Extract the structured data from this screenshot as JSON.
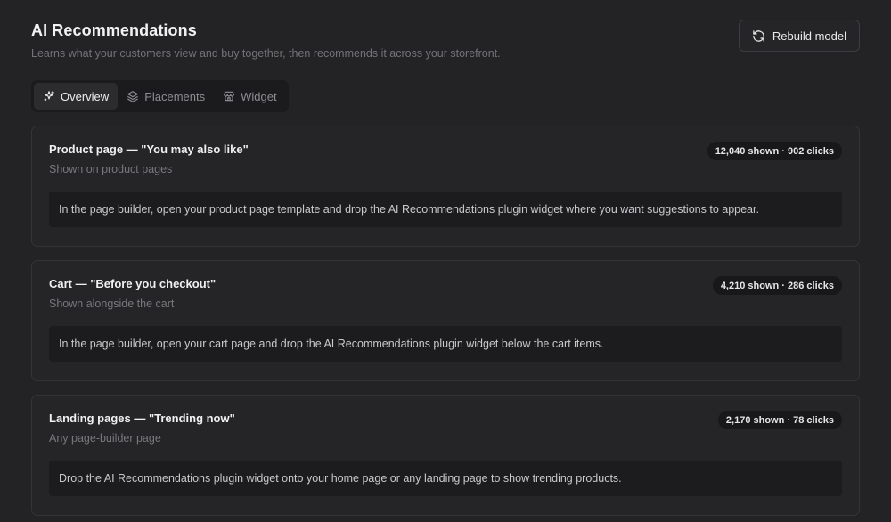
{
  "header": {
    "title": "AI Recommendations",
    "subtitle": "Learns what your customers view and buy together, then recommends it across your storefront.",
    "rebuild_label": "Rebuild model"
  },
  "tabs": [
    {
      "label": "Overview",
      "icon": "sparkle-icon",
      "active": true
    },
    {
      "label": "Placements",
      "icon": "layers-icon",
      "active": false
    },
    {
      "label": "Widget",
      "icon": "storefront-icon",
      "active": false
    }
  ],
  "placements": [
    {
      "title": "Product page — \"You may also like\"",
      "subtitle": "Shown on product pages",
      "stats": "12,040 shown · 902 clicks",
      "instruction": "In the page builder, open your product page template and drop the AI Recommendations plugin widget where you want suggestions to appear."
    },
    {
      "title": "Cart — \"Before you checkout\"",
      "subtitle": "Shown alongside the cart",
      "stats": "4,210 shown · 286 clicks",
      "instruction": "In the page builder, open your cart page and drop the AI Recommendations plugin widget below the cart items."
    },
    {
      "title": "Landing pages — \"Trending now\"",
      "subtitle": "Any page-builder page",
      "stats": "2,170 shown · 78 clicks",
      "instruction": "Drop the AI Recommendations plugin widget onto your home page or any landing page to show trending products."
    }
  ],
  "colors": {
    "background": "#232325",
    "card": "#252527",
    "border": "#343437",
    "instruction_bg": "#1c1c1e"
  }
}
